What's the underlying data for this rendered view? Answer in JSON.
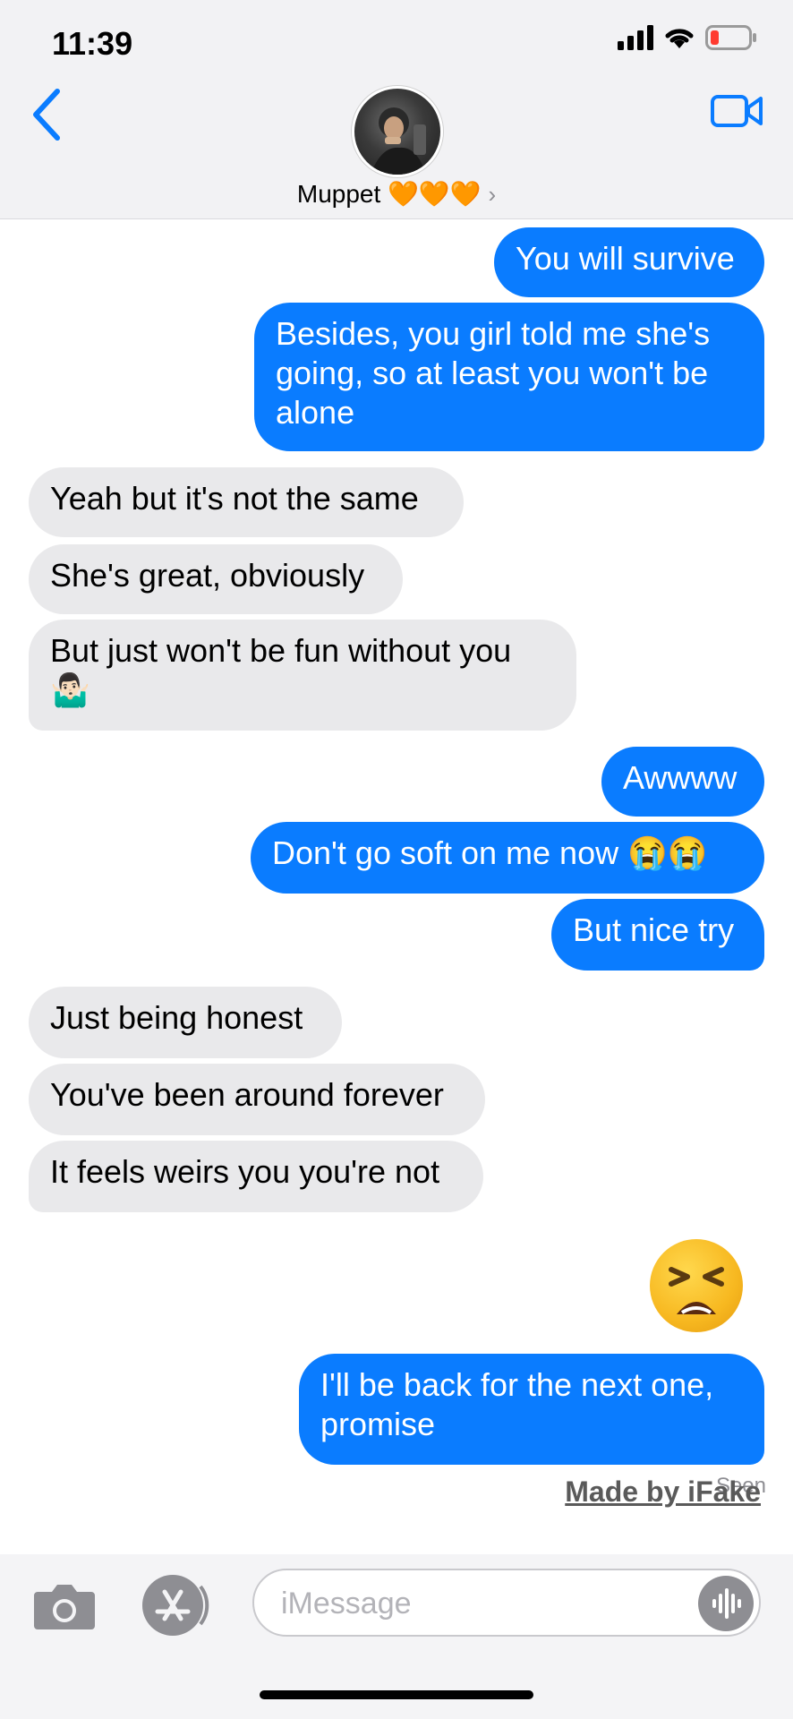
{
  "status_bar": {
    "time": "11:39"
  },
  "header": {
    "contact_name": "Muppet",
    "hearts": "🧡🧡🧡",
    "chevron": "›"
  },
  "messages": [
    {
      "side": "sent",
      "text": "You will survive"
    },
    {
      "side": "sent",
      "text": "Besides, you girl told me she's going, so at least you won't be alone"
    },
    {
      "side": "received",
      "text": "Yeah but it's not the same"
    },
    {
      "side": "received",
      "text": "She's great, obviously"
    },
    {
      "side": "received",
      "text": "But just won't be fun without you 🤷🏻‍♂️"
    },
    {
      "side": "sent",
      "text": "Awwww"
    },
    {
      "side": "sent",
      "text": "Don't go soft on me now 😭😭"
    },
    {
      "side": "sent",
      "text": "But nice try"
    },
    {
      "side": "received",
      "text": "Just being honest"
    },
    {
      "side": "received",
      "text": "You've been around forever"
    },
    {
      "side": "received",
      "text": "It feels weirs you you're not"
    },
    {
      "side": "sent",
      "text": "😫"
    },
    {
      "side": "sent",
      "text": "I'll be back for the next one, promise"
    }
  ],
  "receipt": {
    "seen": "Seen"
  },
  "watermark": "Made by iFake",
  "composer": {
    "placeholder": "iMessage"
  },
  "colors": {
    "sent_bubble": "#0a7cff",
    "received_bubble": "#e9e9eb",
    "accent": "#0a7cff"
  },
  "icons": [
    "back-chevron-icon",
    "video-call-icon",
    "camera-icon",
    "app-store-icon",
    "audio-waveform-icon",
    "signal-icon",
    "wifi-icon",
    "battery-icon"
  ]
}
